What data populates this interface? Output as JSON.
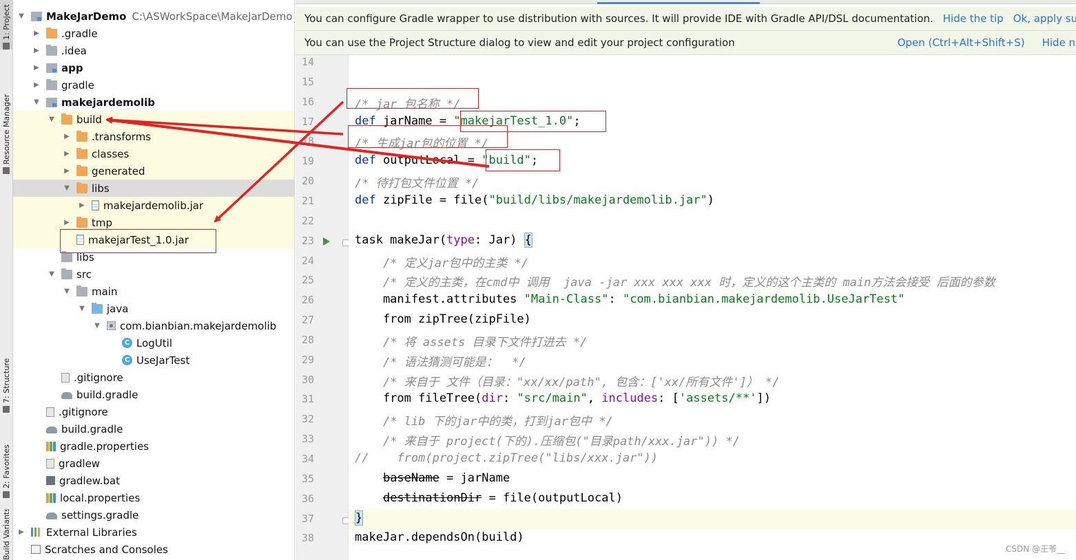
{
  "left_strip": {
    "tabs": [
      "1: Project",
      "Resource Manager",
      "7: Structure",
      "2: Favorites",
      "Build Variants"
    ]
  },
  "project_tree": [
    {
      "label": "MakeJarDemo",
      "path": "C:\\ASWorkSpace\\MakeJarDemo",
      "icon": "module-folder-icon",
      "indent": 0,
      "arrow": "expanded",
      "bold": true
    },
    {
      "label": ".gradle",
      "icon": "orange-folder-icon",
      "indent": 1,
      "arrow": "collapsed"
    },
    {
      "label": ".idea",
      "icon": "gray-folder-icon",
      "indent": 1,
      "arrow": "collapsed"
    },
    {
      "label": "app",
      "icon": "module-folder-icon",
      "indent": 1,
      "arrow": "collapsed",
      "bold": true
    },
    {
      "label": "gradle",
      "icon": "gray-folder-icon",
      "indent": 1,
      "arrow": "collapsed"
    },
    {
      "label": "makejardemolib",
      "icon": "module-folder-icon",
      "indent": 1,
      "arrow": "expanded",
      "bold": true
    },
    {
      "label": "build",
      "icon": "orange-folder-icon",
      "indent": 2,
      "arrow": "expanded",
      "highlight": true
    },
    {
      "label": ".transforms",
      "icon": "orange-folder-icon",
      "indent": 3,
      "arrow": "collapsed",
      "highlight": true
    },
    {
      "label": "classes",
      "icon": "orange-folder-icon",
      "indent": 3,
      "arrow": "collapsed",
      "highlight": true
    },
    {
      "label": "generated",
      "icon": "orange-folder-icon",
      "indent": 3,
      "arrow": "collapsed",
      "highlight": true
    },
    {
      "label": "libs",
      "icon": "orange-folder-icon",
      "indent": 3,
      "arrow": "expanded",
      "selected": true
    },
    {
      "label": "makejardemolib.jar",
      "icon": "jar-icon",
      "indent": 4,
      "arrow": "collapsed",
      "highlight": true
    },
    {
      "label": "tmp",
      "icon": "orange-folder-icon",
      "indent": 3,
      "arrow": "collapsed",
      "highlight": true
    },
    {
      "label": "makejarTest_1.0.jar",
      "icon": "jar-icon",
      "indent": 3,
      "arrow": "none",
      "highlight": true
    },
    {
      "label": "libs",
      "icon": "gray-folder-icon",
      "indent": 2,
      "arrow": "none"
    },
    {
      "label": "src",
      "icon": "gray-folder-icon",
      "indent": 2,
      "arrow": "expanded"
    },
    {
      "label": "main",
      "icon": "gray-folder-icon",
      "indent": 3,
      "arrow": "expanded"
    },
    {
      "label": "java",
      "icon": "blue-folder-icon",
      "indent": 4,
      "arrow": "expanded"
    },
    {
      "label": "com.bianbian.makejardemolib",
      "icon": "package-icon",
      "indent": 5,
      "arrow": "expanded"
    },
    {
      "label": "LogUtil",
      "icon": "class-icon",
      "indent": 6,
      "arrow": "none"
    },
    {
      "label": "UseJarTest",
      "icon": "class-icon",
      "indent": 6,
      "arrow": "none"
    },
    {
      "label": ".gitignore",
      "icon": "file-icon",
      "indent": 2,
      "arrow": "none"
    },
    {
      "label": "build.gradle",
      "icon": "gradle-icon",
      "indent": 2,
      "arrow": "none"
    },
    {
      "label": ".gitignore",
      "icon": "file-icon",
      "indent": 1,
      "arrow": "none"
    },
    {
      "label": "build.gradle",
      "icon": "gradle-icon",
      "indent": 1,
      "arrow": "none"
    },
    {
      "label": "gradle.properties",
      "icon": "properties-icon",
      "indent": 1,
      "arrow": "none"
    },
    {
      "label": "gradlew",
      "icon": "script-icon",
      "indent": 1,
      "arrow": "none"
    },
    {
      "label": "gradlew.bat",
      "icon": "batch-icon",
      "indent": 1,
      "arrow": "none"
    },
    {
      "label": "local.properties",
      "icon": "properties-icon",
      "indent": 1,
      "arrow": "none"
    },
    {
      "label": "settings.gradle",
      "icon": "gradle-icon",
      "indent": 1,
      "arrow": "none"
    },
    {
      "label": "External Libraries",
      "icon": "libraries-icon",
      "indent": 0,
      "arrow": "collapsed"
    },
    {
      "label": "Scratches and Consoles",
      "icon": "scratches-icon",
      "indent": 0,
      "arrow": "none"
    }
  ],
  "banners": {
    "gradle_tip": {
      "message": "You can configure Gradle wrapper to use distribution with sources. It will provide IDE with Gradle API/DSL documentation.",
      "hide": "Hide the tip",
      "apply": "Ok, apply sugg"
    },
    "structure_tip": {
      "message": "You can use the Project Structure dialog to view and edit your project configuration",
      "open": "Open (Ctrl+Alt+Shift+S)",
      "hide": "Hide notif"
    }
  },
  "editor": {
    "current_line": 37,
    "run_gutter_line": 23,
    "lines": [
      {
        "n": "14",
        "tokens": []
      },
      {
        "n": "15",
        "tokens": []
      },
      {
        "n": "16",
        "tokens": [
          {
            "t": "/* jar 包名称 */",
            "c": "cm"
          }
        ]
      },
      {
        "n": "17",
        "tokens": [
          {
            "t": "def",
            "c": "kw"
          },
          {
            "t": " jarName = "
          },
          {
            "t": "\"makejarTest_1.0\"",
            "c": "st"
          },
          {
            "t": ";"
          }
        ]
      },
      {
        "n": "18",
        "tokens": [
          {
            "t": "/* 生成jar包的位置 */",
            "c": "cm"
          }
        ]
      },
      {
        "n": "19",
        "tokens": [
          {
            "t": "def",
            "c": "kw"
          },
          {
            "t": " outputLocal = "
          },
          {
            "t": "\"build\"",
            "c": "st"
          },
          {
            "t": ";"
          }
        ]
      },
      {
        "n": "20",
        "tokens": [
          {
            "t": "/* 待打包文件位置 */",
            "c": "cm"
          }
        ]
      },
      {
        "n": "21",
        "tokens": [
          {
            "t": "def",
            "c": "kw"
          },
          {
            "t": " zipFile = file("
          },
          {
            "t": "\"build/libs/makejardemolib.jar\"",
            "c": "st"
          },
          {
            "t": ")"
          }
        ]
      },
      {
        "n": "22",
        "tokens": []
      },
      {
        "n": "23",
        "tokens": [
          {
            "t": "task makeJar("
          },
          {
            "t": "type",
            "c": "pn"
          },
          {
            "t": ": Jar) "
          },
          {
            "t": "{",
            "c": "brk"
          }
        ]
      },
      {
        "n": "24",
        "tokens": [
          {
            "t": "    "
          },
          {
            "t": "/* 定义jar包中的主类 */",
            "c": "cm"
          }
        ]
      },
      {
        "n": "25",
        "tokens": [
          {
            "t": "    "
          },
          {
            "t": "/* 定义的主类，在cmd中 调用  java -jar xxx xxx xxx 时，定义的这个主类的 main方法会接受 后面的参数",
            "c": "cm"
          }
        ]
      },
      {
        "n": "26",
        "tokens": [
          {
            "t": "    manifest.attributes "
          },
          {
            "t": "\"Main-Class\"",
            "c": "st"
          },
          {
            "t": ": "
          },
          {
            "t": "\"com.bianbian.makejardemolib.UseJarTest\"",
            "c": "st"
          }
        ]
      },
      {
        "n": "27",
        "tokens": [
          {
            "t": "    from zipTree(zipFile)"
          }
        ]
      },
      {
        "n": "28",
        "tokens": [
          {
            "t": "    "
          },
          {
            "t": "/* 将 assets 目录下文件打进去 */",
            "c": "cm"
          }
        ]
      },
      {
        "n": "29",
        "tokens": [
          {
            "t": "    "
          },
          {
            "t": "/* 语法猜测可能是：  */",
            "c": "cm"
          }
        ]
      },
      {
        "n": "30",
        "tokens": [
          {
            "t": "    "
          },
          {
            "t": "/* 来自于 文件（目录：\"xx/xx/path\", 包含：['xx/所有文件']） */",
            "c": "cm"
          }
        ]
      },
      {
        "n": "31",
        "tokens": [
          {
            "t": "    from fileTree("
          },
          {
            "t": "dir",
            "c": "pn"
          },
          {
            "t": ": "
          },
          {
            "t": "\"src/main\"",
            "c": "st"
          },
          {
            "t": ", "
          },
          {
            "t": "includes",
            "c": "pn"
          },
          {
            "t": ": ["
          },
          {
            "t": "'assets/**'",
            "c": "st"
          },
          {
            "t": "])"
          }
        ]
      },
      {
        "n": "32",
        "tokens": [
          {
            "t": "    "
          },
          {
            "t": "/* lib 下的jar中的类，打到jar包中 */",
            "c": "cm"
          }
        ]
      },
      {
        "n": "33",
        "tokens": [
          {
            "t": "    "
          },
          {
            "t": "/* 来自于 project(下的).压缩包(\"目录path/xxx.jar\")) */",
            "c": "cm"
          }
        ]
      },
      {
        "n": "34",
        "tokens": [
          {
            "t": "//    from(project.zipTree(\"libs/xxx.jar\"))",
            "c": "cm"
          }
        ]
      },
      {
        "n": "35",
        "tokens": [
          {
            "t": "    "
          },
          {
            "t": "baseName",
            "c": "strike"
          },
          {
            "t": " = jarName"
          }
        ]
      },
      {
        "n": "36",
        "tokens": [
          {
            "t": "    "
          },
          {
            "t": "destinationDir",
            "c": "strike"
          },
          {
            "t": " = file(outputLocal)"
          }
        ]
      },
      {
        "n": "37",
        "tokens": [
          {
            "t": "}",
            "c": "brk"
          }
        ]
      },
      {
        "n": "38",
        "tokens": [
          {
            "t": "makeJar.dependsOn(build)"
          }
        ]
      }
    ]
  },
  "watermark": "CSDN @王爷__",
  "colors": {
    "annotation_red": "#e02020",
    "keyword": "#0033b3",
    "string": "#067d17",
    "comment": "#8c8c8c",
    "param": "#871094",
    "link": "#2a74d3"
  }
}
